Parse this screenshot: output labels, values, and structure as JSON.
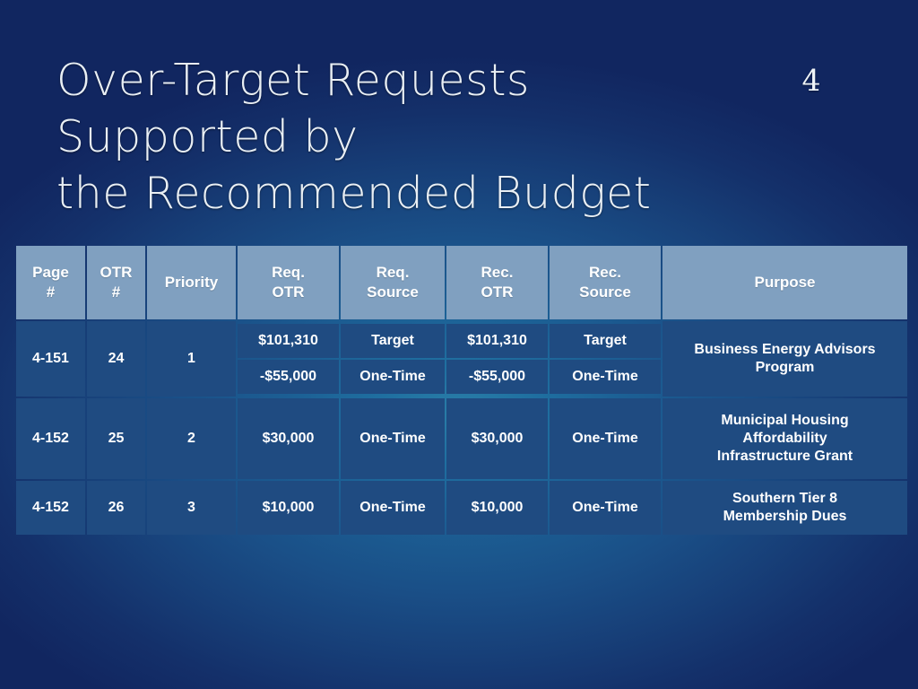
{
  "slide": {
    "number": "4",
    "title_lines": [
      "Over-Target Requests",
      "Supported by",
      "the Recommended Budget"
    ],
    "colors": {
      "background_dark": "#112660",
      "background_center": "#2a7ea8",
      "header_cell": "#80a0c0",
      "body_cell": "#1f4b81",
      "text": "#ffffff",
      "title_text": "#e9eff4"
    }
  },
  "table": {
    "headers": {
      "page": "Page\n#",
      "page_line1": "Page",
      "page_line2": "#",
      "otr_line1": "OTR",
      "otr_line2": "#",
      "priority": "Priority",
      "req_otr_line1": "Req.",
      "req_otr_line2": "OTR",
      "req_source_line1": "Req.",
      "req_source_line2": "Source",
      "rec_otr_line1": "Rec.",
      "rec_otr_line2": "OTR",
      "rec_source_line1": "Rec.",
      "rec_source_line2": "Source",
      "purpose": "Purpose"
    },
    "rows": [
      {
        "page": "4-151",
        "otr": "24",
        "priority": "1",
        "req_otr": [
          "$101,310",
          "-$55,000"
        ],
        "req_source": [
          "Target",
          "One-Time"
        ],
        "rec_otr": [
          "$101,310",
          "-$55,000"
        ],
        "rec_source": [
          "Target",
          "One-Time"
        ],
        "purpose_line1": "Business Energy Advisors",
        "purpose_line2": "Program"
      },
      {
        "page": "4-152",
        "otr": "25",
        "priority": "2",
        "req_otr": [
          "$30,000"
        ],
        "req_source": [
          "One-Time"
        ],
        "rec_otr": [
          "$30,000"
        ],
        "rec_source": [
          "One-Time"
        ],
        "purpose_line1": "Municipal Housing",
        "purpose_line2": "Affordability",
        "purpose_line3": "Infrastructure Grant"
      },
      {
        "page": "4-152",
        "otr": "26",
        "priority": "3",
        "req_otr": [
          "$10,000"
        ],
        "req_source": [
          "One-Time"
        ],
        "rec_otr": [
          "$10,000"
        ],
        "rec_source": [
          "One-Time"
        ],
        "purpose_line1": "Southern Tier 8",
        "purpose_line2": "Membership Dues"
      }
    ]
  }
}
